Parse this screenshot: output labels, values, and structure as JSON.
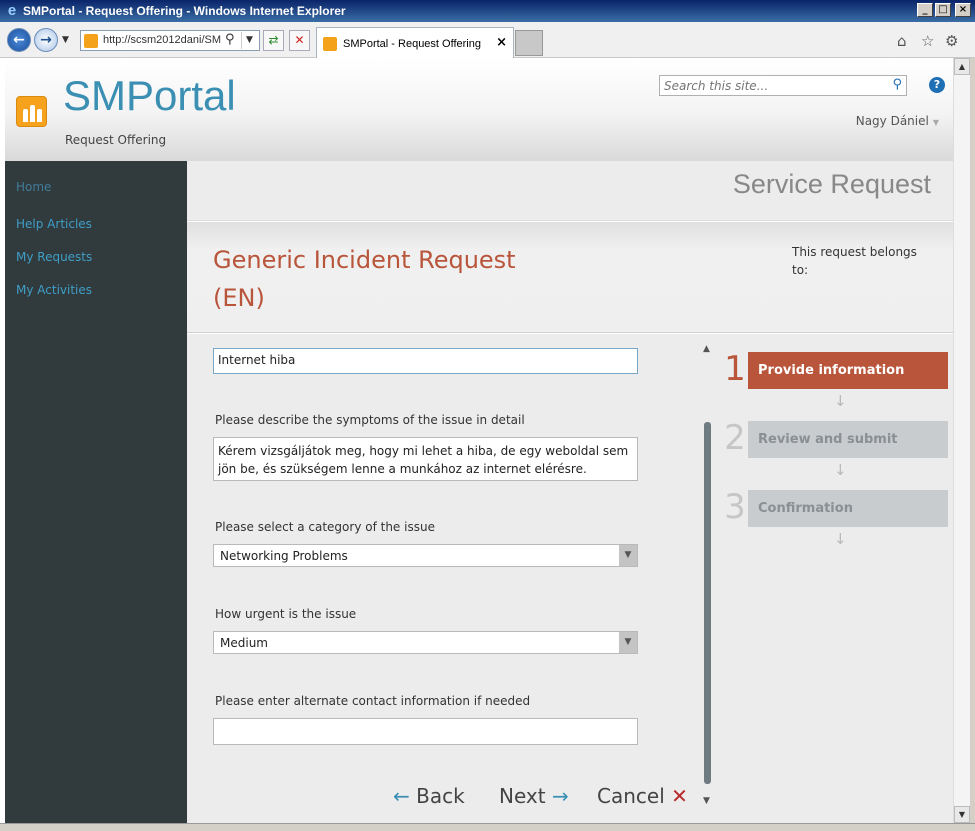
{
  "window": {
    "title": "SMPortal - Request Offering - Windows Internet Explorer",
    "min": "_",
    "max": "□",
    "close": "×"
  },
  "browser": {
    "address": "http://scsm2012dani/SM",
    "tab_title": "SMPortal - Request Offering",
    "tab_close": "×"
  },
  "header": {
    "site_name": "SMPortal",
    "subtitle": "Request Offering",
    "search_placeholder": "Search this site...",
    "help": "?",
    "user": "Nagy Dániel"
  },
  "sidebar": {
    "items": [
      {
        "label": "Home"
      },
      {
        "label": "Help Articles"
      },
      {
        "label": "My Requests"
      },
      {
        "label": "My Activities"
      }
    ]
  },
  "page": {
    "section": "Service Request",
    "request_title": "Generic Incident Request (EN)",
    "belongs_to": "This request belongs to:"
  },
  "form": {
    "title_value": "Internet hiba",
    "symptoms_label": "Please describe the symptoms of the issue in detail",
    "symptoms_value": "Kérem vizsgáljátok meg, hogy mi lehet a hiba, de egy weboldal sem jön be, és szükségem lenne a munkához az internet elérésre.",
    "category_label": "Please select a category of the issue",
    "category_value": "Networking Problems",
    "urgency_label": "How urgent is the issue",
    "urgency_value": "Medium",
    "contact_label": "Please enter alternate contact information if needed",
    "contact_value": ""
  },
  "steps": [
    {
      "num": "1",
      "label": "Provide information",
      "active": true
    },
    {
      "num": "2",
      "label": "Review and submit",
      "active": false
    },
    {
      "num": "3",
      "label": "Confirmation",
      "active": false
    }
  ],
  "buttons": {
    "back": "Back",
    "next": "Next",
    "cancel": "Cancel"
  },
  "colors": {
    "accent": "#b8553a",
    "link": "#3f9ec7",
    "sidebar_bg": "#313a3d",
    "logo": "#f7a21c"
  },
  "icons": {
    "app": "ie-icon",
    "back": "arrow-left-icon",
    "next": "arrow-right-icon",
    "cancel": "close-icon",
    "search": "search-icon",
    "help": "help-icon"
  }
}
